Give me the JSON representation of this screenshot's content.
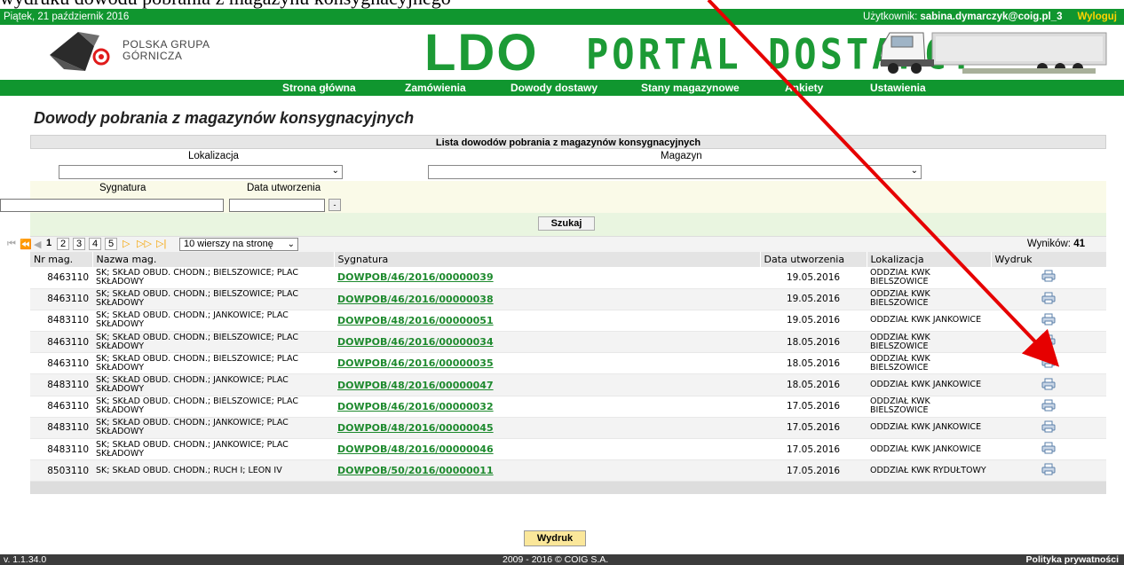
{
  "doc_text": "wydruku dowodu pobrania z magazynu konsygnacyjnego",
  "topbar": {
    "date": "Piątek, 21 październik 2016",
    "user_label": "Użytkownik:",
    "user_value": "sabina.dymarczyk@coig.pl_3",
    "logout": "Wyloguj"
  },
  "header": {
    "logo_line1": "POLSKA GRUPA",
    "logo_line2": "GÓRNICZA",
    "ldo": "LDO",
    "portal": "PORTAL DOSTAWCY"
  },
  "nav": [
    "Strona główna",
    "Zamówienia",
    "Dowody dostawy",
    "Stany magazynowe",
    "Ankiety",
    "Ustawienia"
  ],
  "page_title": "Dowody pobrania z magazynów konsygnacyjnych",
  "panel": {
    "heading": "Lista dowodów pobrania z magazynów konsygnacyjnych",
    "lokalizacja_label": "Lokalizacja",
    "magazyn_label": "Magazyn",
    "sygnatura_label": "Sygnatura",
    "data_label": "Data utworzenia",
    "search_button": "Szukaj"
  },
  "pager": {
    "pages": [
      "1",
      "2",
      "3",
      "4",
      "5"
    ],
    "current": "1",
    "per_page": "10 wierszy na stronę",
    "results_label": "Wyników:",
    "results_count": "41"
  },
  "columns": [
    "Nr mag.",
    "Nazwa mag.",
    "Sygnatura",
    "Data utworzenia",
    "Lokalizacja",
    "Wydruk"
  ],
  "rows": [
    {
      "nr": "8463110",
      "nazwa": "SK; SKŁAD OBUD. CHODN.; BIELSZOWICE; PLAC SKŁADOWY",
      "syg": "DOWPOB/46/2016/00000039",
      "data": "19.05.2016",
      "lok": "ODDZIAŁ KWK BIELSZOWICE"
    },
    {
      "nr": "8463110",
      "nazwa": "SK; SKŁAD OBUD. CHODN.; BIELSZOWICE; PLAC SKŁADOWY",
      "syg": "DOWPOB/46/2016/00000038",
      "data": "19.05.2016",
      "lok": "ODDZIAŁ KWK BIELSZOWICE"
    },
    {
      "nr": "8483110",
      "nazwa": "SK; SKŁAD OBUD. CHODN.; JANKOWICE; PLAC SKŁADOWY",
      "syg": "DOWPOB/48/2016/00000051",
      "data": "19.05.2016",
      "lok": "ODDZIAŁ KWK JANKOWICE"
    },
    {
      "nr": "8463110",
      "nazwa": "SK; SKŁAD OBUD. CHODN.; BIELSZOWICE; PLAC SKŁADOWY",
      "syg": "DOWPOB/46/2016/00000034",
      "data": "18.05.2016",
      "lok": "ODDZIAŁ KWK BIELSZOWICE"
    },
    {
      "nr": "8463110",
      "nazwa": "SK; SKŁAD OBUD. CHODN.; BIELSZOWICE; PLAC SKŁADOWY",
      "syg": "DOWPOB/46/2016/00000035",
      "data": "18.05.2016",
      "lok": "ODDZIAŁ KWK BIELSZOWICE"
    },
    {
      "nr": "8483110",
      "nazwa": "SK; SKŁAD OBUD. CHODN.; JANKOWICE; PLAC SKŁADOWY",
      "syg": "DOWPOB/48/2016/00000047",
      "data": "18.05.2016",
      "lok": "ODDZIAŁ KWK JANKOWICE"
    },
    {
      "nr": "8463110",
      "nazwa": "SK; SKŁAD OBUD. CHODN.; BIELSZOWICE; PLAC SKŁADOWY",
      "syg": "DOWPOB/46/2016/00000032",
      "data": "17.05.2016",
      "lok": "ODDZIAŁ KWK BIELSZOWICE"
    },
    {
      "nr": "8483110",
      "nazwa": "SK; SKŁAD OBUD. CHODN.; JANKOWICE; PLAC SKŁADOWY",
      "syg": "DOWPOB/48/2016/00000045",
      "data": "17.05.2016",
      "lok": "ODDZIAŁ KWK JANKOWICE"
    },
    {
      "nr": "8483110",
      "nazwa": "SK; SKŁAD OBUD. CHODN.; JANKOWICE; PLAC SKŁADOWY",
      "syg": "DOWPOB/48/2016/00000046",
      "data": "17.05.2016",
      "lok": "ODDZIAŁ KWK JANKOWICE"
    },
    {
      "nr": "8503110",
      "nazwa": "SK; SKŁAD OBUD. CHODN.; RUCH I; LEON IV",
      "syg": "DOWPOB/50/2016/00000011",
      "data": "17.05.2016",
      "lok": "ODDZIAŁ KWK RYDUŁTOWY"
    }
  ],
  "print_button": "Wydruk",
  "footer": {
    "version": "v. 1.1.34.0",
    "copyright": "2009 - 2016 © COIG S.A.",
    "privacy": "Polityka prywatności"
  },
  "colors": {
    "brand_green": "#10962f",
    "link_green": "#1e8a2e",
    "logout_yellow": "#ffd400",
    "annotation_red": "#e60000"
  }
}
